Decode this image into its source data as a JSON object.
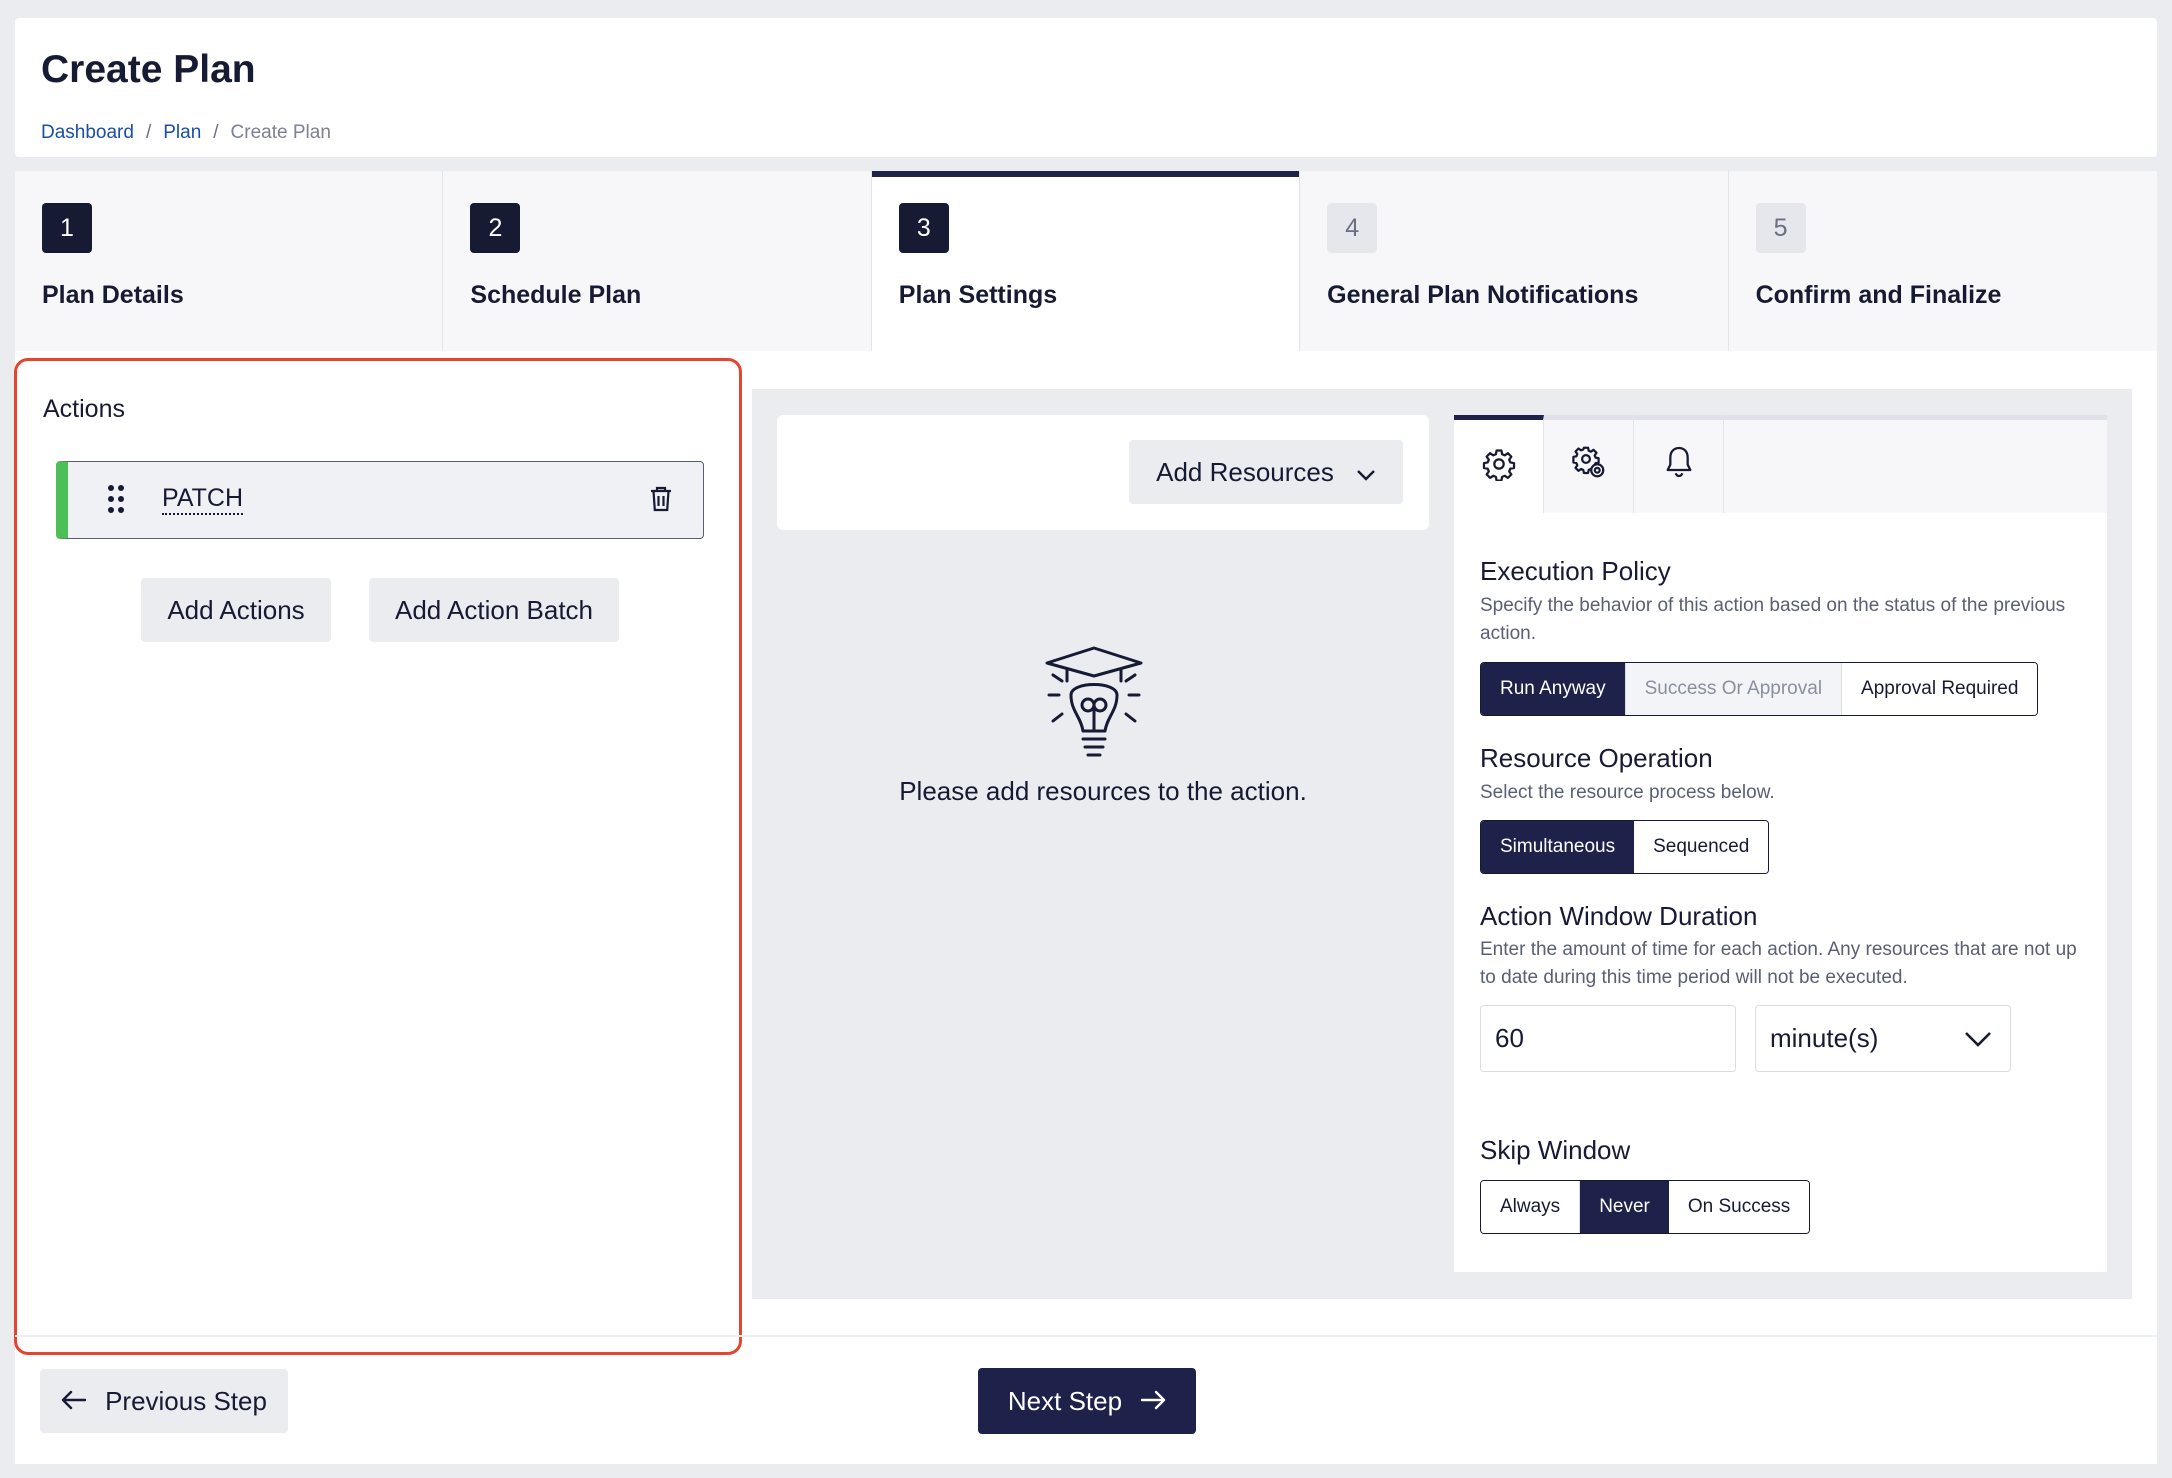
{
  "header": {
    "title": "Create Plan",
    "breadcrumb": [
      "Dashboard",
      "Plan",
      "Create Plan"
    ],
    "separator": "/"
  },
  "steps": [
    {
      "number": "1",
      "label": "Plan Details",
      "state": "done"
    },
    {
      "number": "2",
      "label": "Schedule Plan",
      "state": "done"
    },
    {
      "number": "3",
      "label": "Plan Settings",
      "state": "active"
    },
    {
      "number": "4",
      "label": "General Plan Notifications",
      "state": "todo"
    },
    {
      "number": "5",
      "label": "Confirm and Finalize",
      "state": "todo"
    }
  ],
  "actions": {
    "title": "Actions",
    "items": [
      {
        "name": "PATCH"
      }
    ],
    "add_actions_label": "Add Actions",
    "add_action_batch_label": "Add Action Batch"
  },
  "resources": {
    "add_label": "Add Resources",
    "empty_message": "Please add resources to the action."
  },
  "settings": {
    "tabs": [
      "gear-icon",
      "gears-icon",
      "bell-icon"
    ],
    "execution_policy": {
      "title": "Execution Policy",
      "description": "Specify the behavior of this action based on the status of the previous action.",
      "options": [
        "Run Anyway",
        "Success Or Approval",
        "Approval Required"
      ],
      "selected": "Run Anyway"
    },
    "resource_operation": {
      "title": "Resource Operation",
      "description": "Select the resource process below.",
      "options": [
        "Simultaneous",
        "Sequenced"
      ],
      "selected": "Simultaneous"
    },
    "action_window": {
      "title": "Action Window Duration",
      "description": "Enter the amount of time for each action. Any resources that are not up to date during this time period will not be executed.",
      "value": "60",
      "unit": "minute(s)"
    },
    "skip_window": {
      "title": "Skip Window",
      "options": [
        "Always",
        "Never",
        "On Success"
      ],
      "selected": "Never"
    }
  },
  "footer": {
    "prev_label": "Previous Step",
    "next_label": "Next Step"
  },
  "colors": {
    "primary": "#1e2149",
    "accent_green": "#4cbf56",
    "highlight_red": "#e5452f",
    "background": "#ebecf0"
  }
}
